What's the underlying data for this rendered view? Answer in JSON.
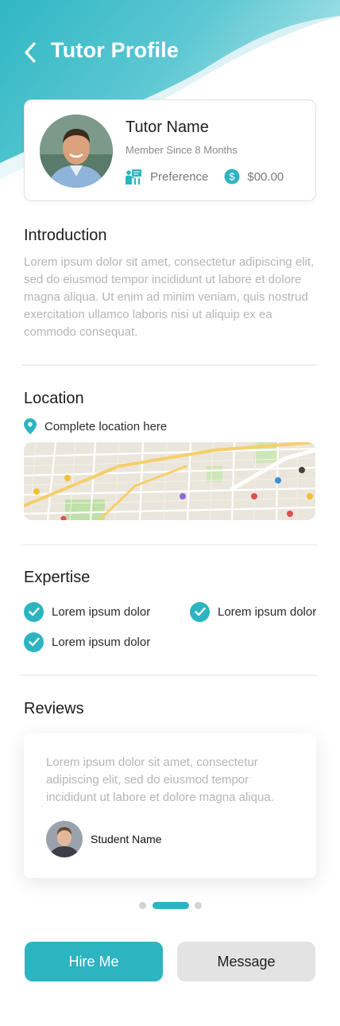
{
  "header": {
    "title": "Tutor Profile",
    "back_icon": "chevron-left-icon",
    "accent_color": "#2cb4c1"
  },
  "profile": {
    "name": "Tutor Name",
    "member_since": "Member Since 8 Months",
    "preference_label": "Preference",
    "price": "$00.00",
    "preference_icon": "teacher-board-icon",
    "price_icon": "dollar-circle-icon"
  },
  "introduction": {
    "heading": "Introduction",
    "text": "Lorem ipsum dolor sit amet, consectetur adipiscing elit, sed do eiusmod tempor incididunt ut labore et dolore magna aliqua. Ut enim ad minim veniam, quis nostrud exercitation ullamco laboris nisi ut aliquip ex ea commodo consequat."
  },
  "location": {
    "heading": "Location",
    "address": "Complete location here",
    "pin_icon": "map-pin-icon"
  },
  "expertise": {
    "heading": "Expertise",
    "items": [
      "Lorem ipsum dolor",
      "Lorem ipsum dolor",
      "Lorem ipsum dolor"
    ]
  },
  "reviews": {
    "heading": "Reviews",
    "items": [
      {
        "text": "Lorem ipsum dolor sit amet, consectetur adipiscing elit, sed do eiusmod tempor incididunt ut labore et dolore magna aliqua.",
        "student_name": "Student Name"
      }
    ],
    "page_count": 3,
    "active_page": 2
  },
  "actions": {
    "hire_label": "Hire Me",
    "message_label": "Message"
  }
}
